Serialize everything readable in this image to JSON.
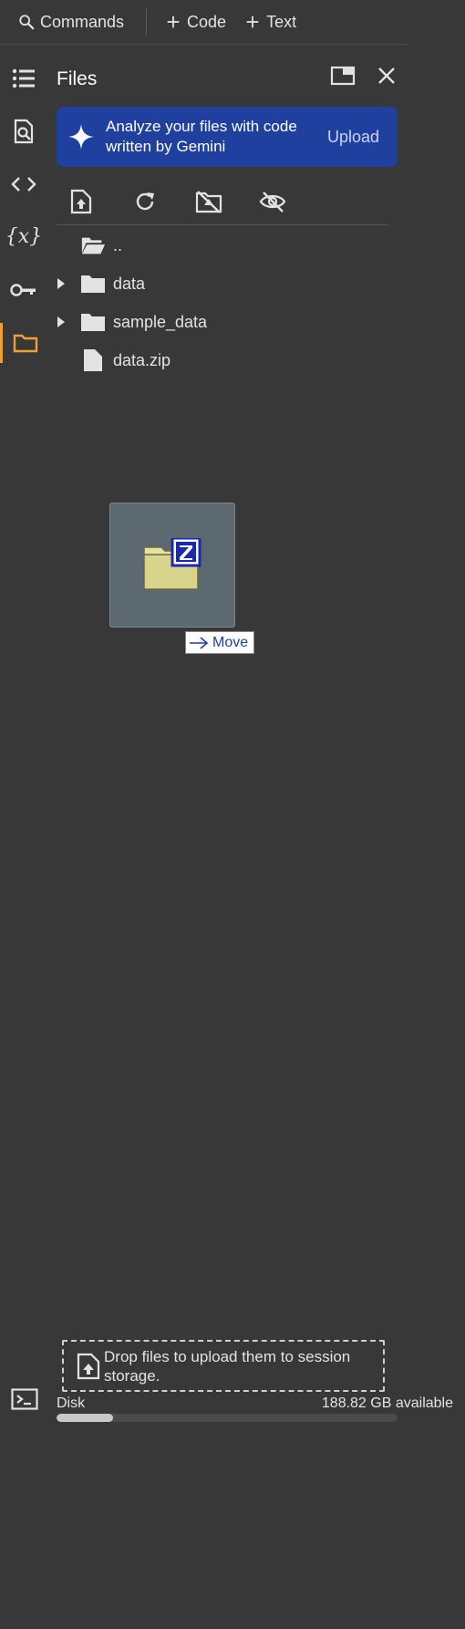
{
  "toolbar": {
    "commands_label": "Commands",
    "code_label": "Code",
    "text_label": "Text"
  },
  "rail": {
    "items": [
      {
        "icon": "table-of-contents-icon"
      },
      {
        "icon": "find-replace-icon"
      },
      {
        "icon": "code-snippets-icon"
      },
      {
        "icon": "variables-icon",
        "glyph": "{x}"
      },
      {
        "icon": "secrets-key-icon"
      },
      {
        "icon": "files-folder-icon",
        "active": true
      }
    ],
    "terminal_icon": "terminal-icon"
  },
  "panel": {
    "title": "Files",
    "banner": {
      "text": "Analyze your files with code written by Gemini",
      "action": "Upload"
    },
    "tools": [
      "upload-file-icon",
      "refresh-icon",
      "unmount-drive-icon",
      "hide-files-icon"
    ],
    "tree": [
      {
        "name": "..",
        "type": "parent-folder",
        "expandable": false
      },
      {
        "name": "data",
        "type": "folder",
        "expandable": true
      },
      {
        "name": "sample_data",
        "type": "folder",
        "expandable": true
      },
      {
        "name": "data.zip",
        "type": "file",
        "expandable": false
      }
    ]
  },
  "drag": {
    "tooltip": "Move"
  },
  "bottom": {
    "dropzone_text": "Drop files to upload them to session storage.",
    "disk_label": "Disk",
    "disk_available": "188.82 GB available",
    "disk_used_fraction": 0.165
  },
  "colors": {
    "background": "#383838",
    "banner": "#2040a0",
    "active_accent": "#f0a030",
    "tooltip_text": "#1c3fa8"
  }
}
